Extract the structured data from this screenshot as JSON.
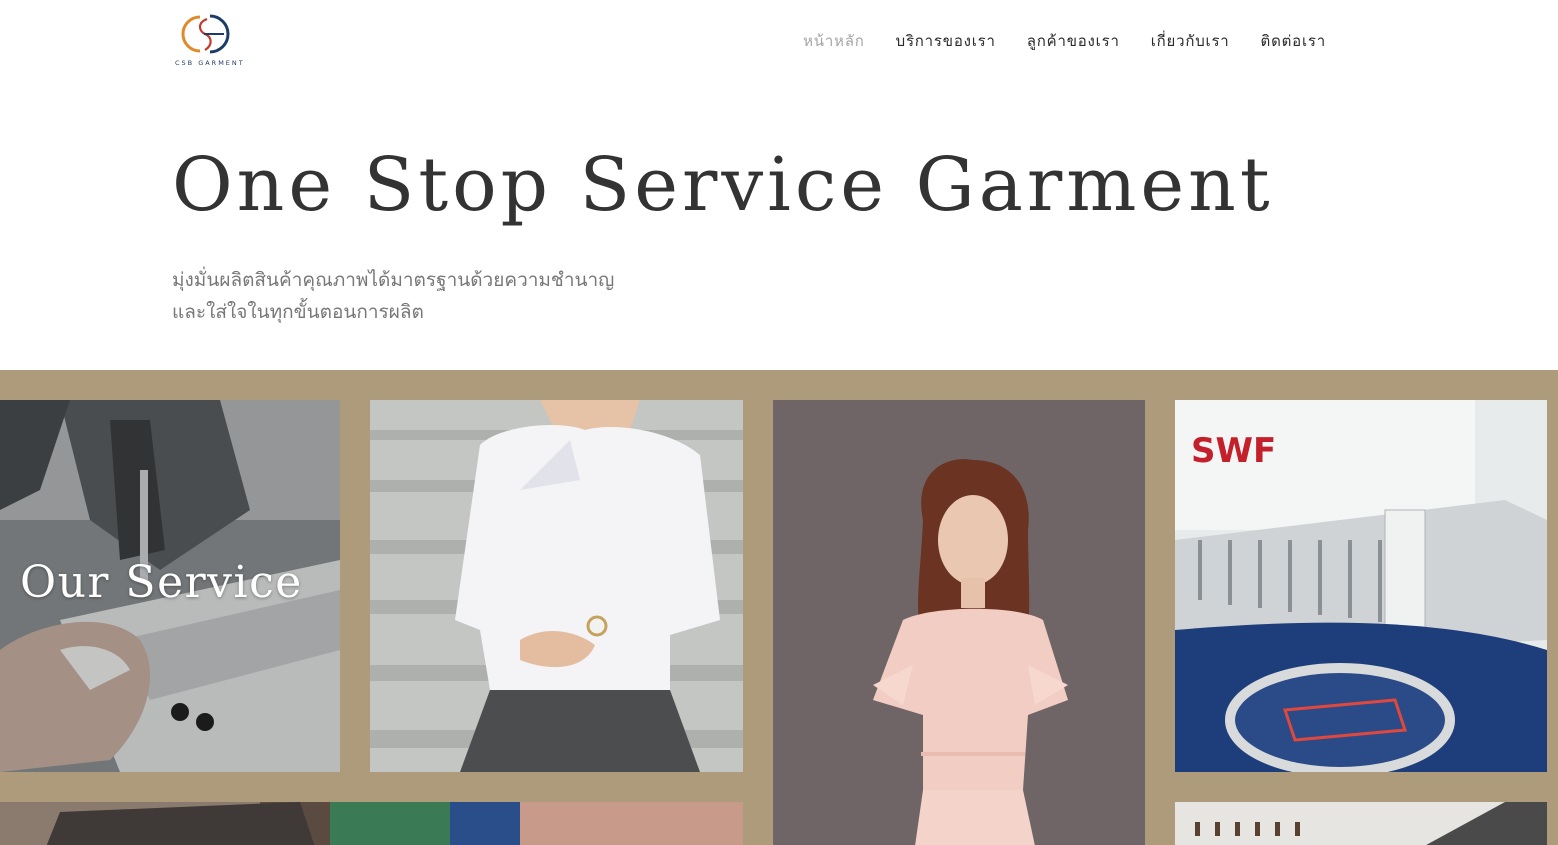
{
  "brand": {
    "logo_text": "CSB GARMENT"
  },
  "nav": {
    "items": [
      "หน้าหลัก",
      "บริการของเรา",
      "ลูกค้าของเรา",
      "เกี่ยวกับเรา",
      "ติดต่อเรา"
    ],
    "active": "หน้าหลัก"
  },
  "hero": {
    "title": "One Stop Service Garment",
    "subtitle_line1": "มุ่งมั่นผลิตสินค้าคุณภาพได้มาตรฐานด้วยความชำนาญ",
    "subtitle_line2": "และใส่ใจในทุกขั้นตอนการผลิต"
  },
  "gallery": {
    "service_title": "Our Service",
    "machine_brand": "SWF"
  },
  "colors": {
    "gallery_bg": "#ad9b7c",
    "nav_active": "#a5a5a5",
    "text_dark": "#333333",
    "logo_orange": "#e08a2a",
    "logo_navy": "#1f3c68"
  }
}
